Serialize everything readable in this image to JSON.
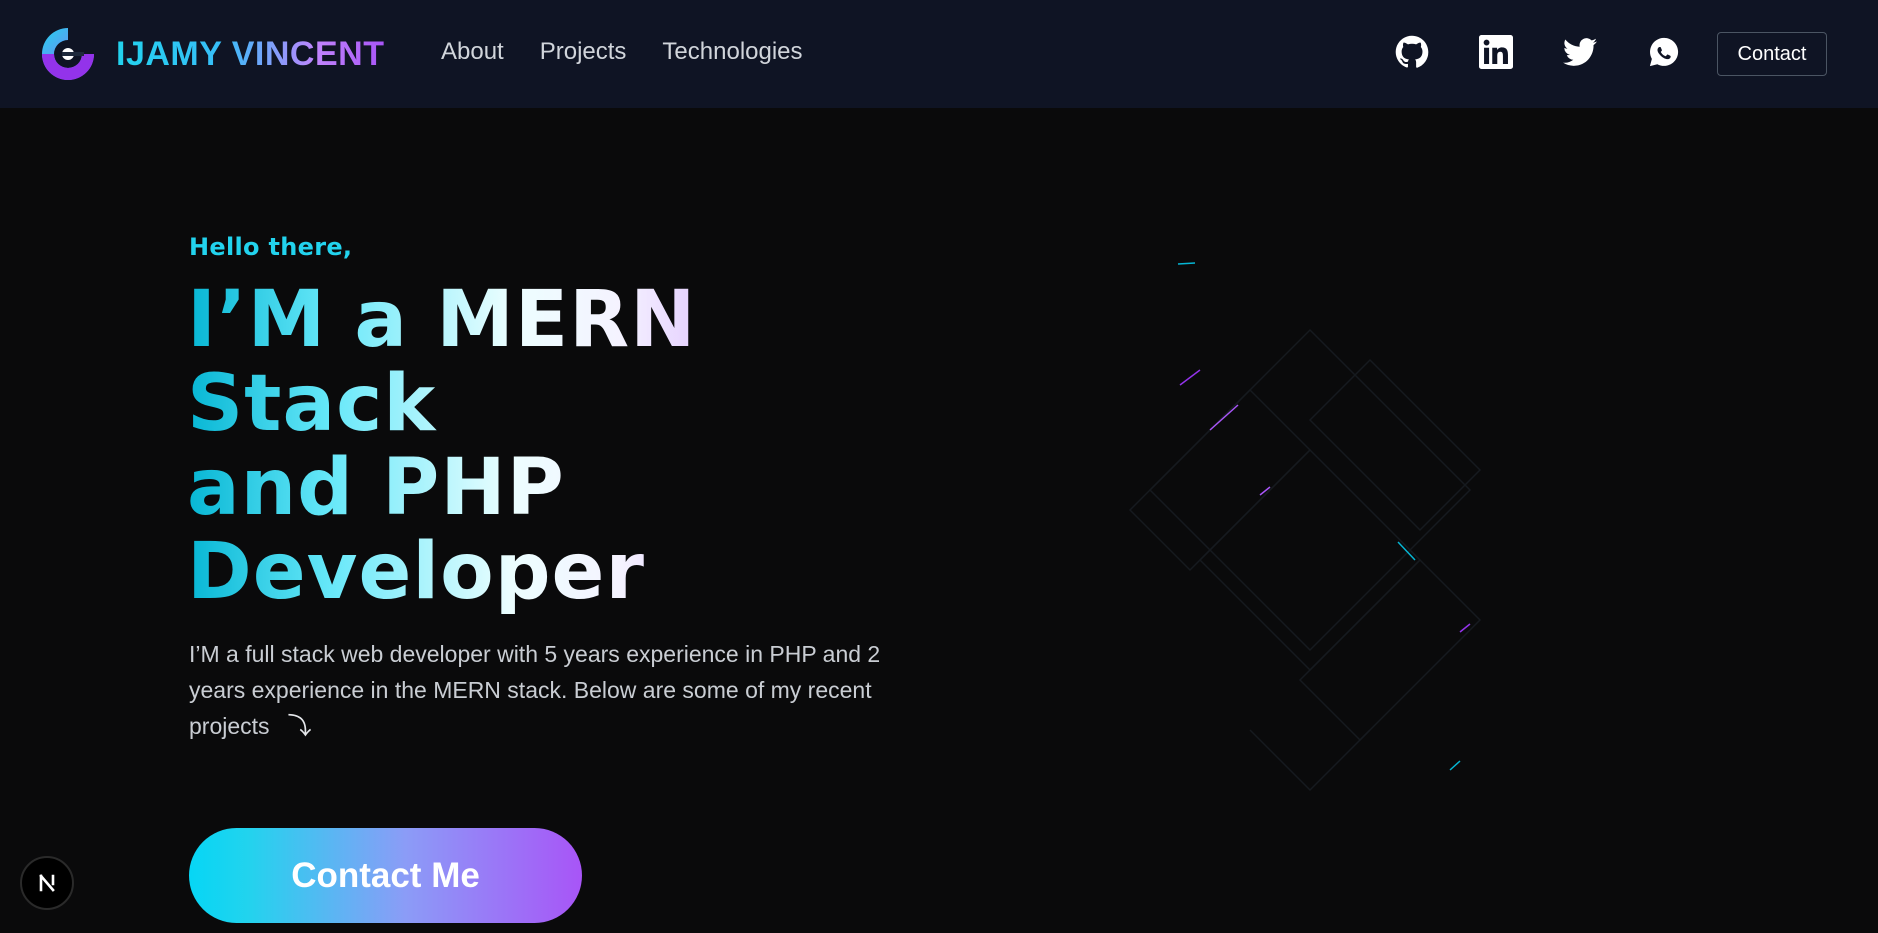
{
  "header": {
    "brand_name": "IJAMY VINCENT",
    "nav_links": [
      {
        "label": "About"
      },
      {
        "label": "Projects"
      },
      {
        "label": "Technologies"
      }
    ],
    "socials": [
      {
        "icon": "github-icon"
      },
      {
        "icon": "linkedin-icon"
      },
      {
        "icon": "twitter-icon"
      },
      {
        "icon": "whatsapp-icon"
      }
    ],
    "contact_label": "Contact"
  },
  "hero": {
    "greeting": "Hello there,",
    "headline_lines": [
      "I’M a MERN",
      "Stack",
      "and PHP",
      "Developer"
    ],
    "intro": "I’M a full stack web developer with 5 years experience in PHP and 2 years experience in the MERN stack. Below are some of my recent projects",
    "arrow_glyph": "⤵",
    "cta_label": "Contact Me"
  },
  "colors": {
    "nav_bg": "#0f1424",
    "page_bg": "#0a0a0b",
    "accent_cyan": "#22d3ee",
    "accent_purple": "#a855f7"
  }
}
